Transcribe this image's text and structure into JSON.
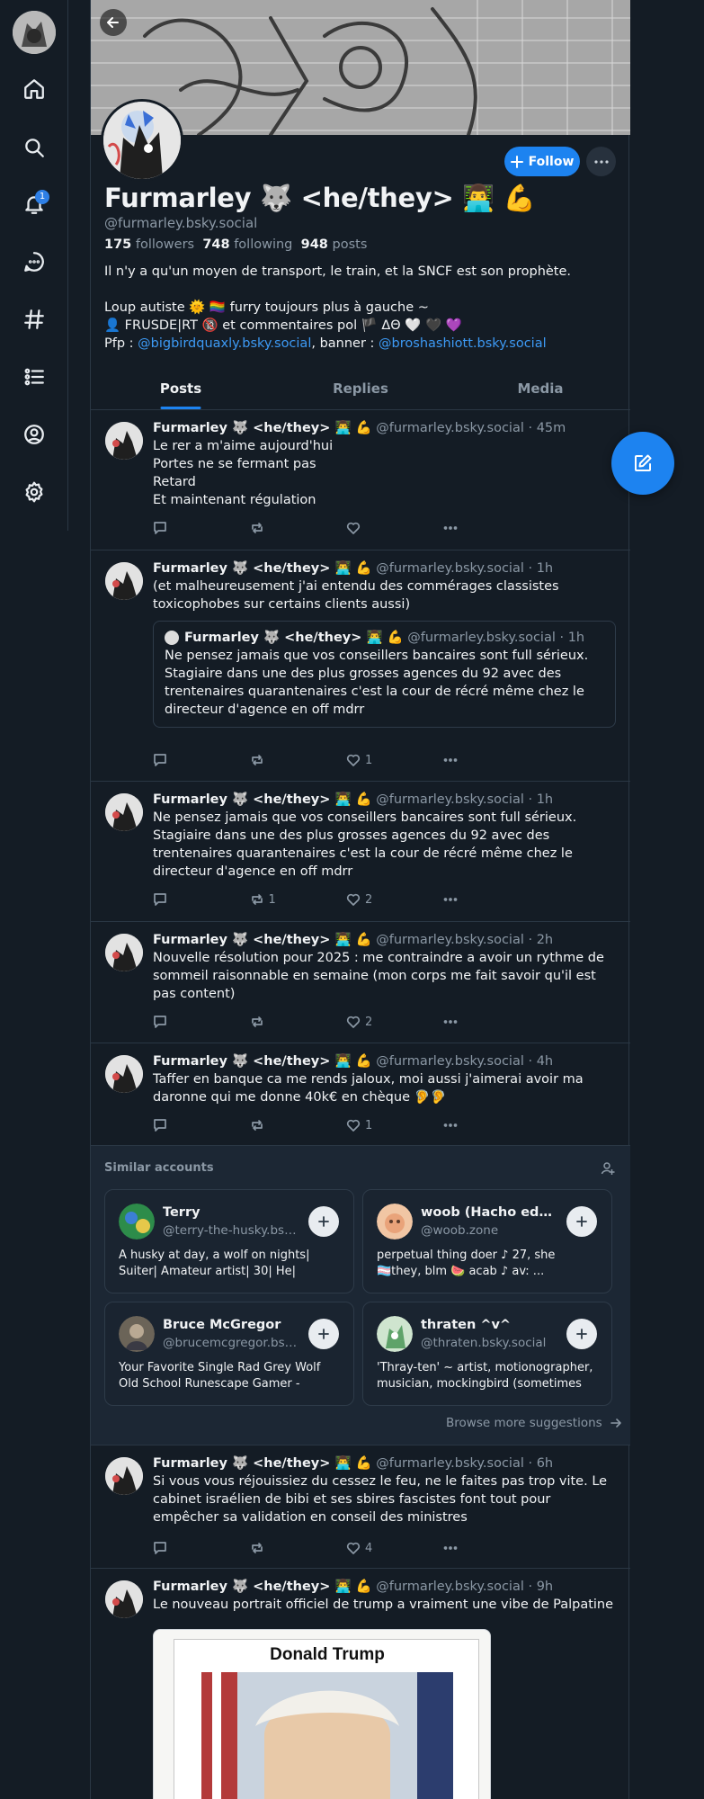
{
  "profile": {
    "display_name": "Furmarley 🐺 <he/they> 👨‍💻 💪",
    "handle": "@furmarley.bsky.social",
    "followers_count": "175",
    "followers_label": " followers",
    "following_count": "748",
    "following_label": " following",
    "posts_count": "948",
    "posts_label": " posts",
    "bio_line1": "Il n'y a qu'un moyen de transport, le train, et la SNCF est son prophète.",
    "bio_line2": "Loup autiste 🌞 🏳️‍🌈 furry toujours plus à gauche ~",
    "bio_line3": "👤 FRUSDE|RT 🔞 et commentaires pol 🏴 ΔΘ 🤍 🖤 💜",
    "bio_pfp_label": "Pfp : ",
    "bio_pfp_link": "@bigbirdquaxly.bsky.social",
    "bio_banner_label": ", banner : ",
    "bio_banner_link": "@broshashiott.bsky.social",
    "follow_label": "Follow"
  },
  "tabs": [
    "Posts",
    "Replies",
    "Media"
  ],
  "posts": [
    {
      "name": "Furmarley 🐺 <he/they> 👨‍💻 💪",
      "meta": " @furmarley.bsky.social · 45m",
      "text": "Le rer a m'aime aujourd'hui\nPortes ne se fermant pas\nRetard\nEt maintenant régulation",
      "reposts": "",
      "likes": ""
    },
    {
      "name": "Furmarley 🐺 <he/they> 👨‍💻 💪",
      "meta": " @furmarley.bsky.social · 1h",
      "text": "(et malheureusement j'ai entendu des commérages classistes toxicophobes sur certains clients aussi)",
      "quote_name": "Furmarley 🐺 <he/they> 👨‍💻 💪",
      "quote_meta": " @furmarley.bsky.social · 1h",
      "quote_text": "Ne pensez jamais que vos conseillers bancaires sont full sérieux. Stagiaire dans une des plus grosses agences du 92 avec des trentenaires quarantenaires c'est la cour de récré même chez le directeur d'agence en off mdrr",
      "reposts": "",
      "likes": "1"
    },
    {
      "name": "Furmarley 🐺 <he/they> 👨‍💻 💪",
      "meta": " @furmarley.bsky.social · 1h",
      "text": "Ne pensez jamais que vos conseillers bancaires sont full sérieux. Stagiaire dans une des plus grosses agences du 92 avec des trentenaires quarantenaires c'est la cour de récré même chez le directeur d'agence en off mdrr",
      "reposts": "1",
      "likes": "2"
    },
    {
      "name": "Furmarley 🐺 <he/they> 👨‍💻 💪",
      "meta": " @furmarley.bsky.social · 2h",
      "text": "Nouvelle résolution pour 2025 : me contraindre a avoir un rythme de sommeil raisonnable en semaine (mon corps me fait savoir qu'il est pas content)",
      "reposts": "",
      "likes": "2"
    },
    {
      "name": "Furmarley 🐺 <he/they> 👨‍💻 💪",
      "meta": " @furmarley.bsky.social · 4h",
      "text": "Taffer en banque ca me rends jaloux, moi aussi j'aimerai avoir ma daronne qui me donne 40k€ en chèque 🦻🦻",
      "reposts": "",
      "likes": "1"
    },
    {
      "name": "Furmarley 🐺 <he/they> 👨‍💻 💪",
      "meta": " @furmarley.bsky.social · 6h",
      "text": "Si vous vous réjouissiez du cessez le feu, ne le faites pas trop vite. Le cabinet israélien de bibi et ses sbires fascistes font tout pour empêcher sa validation en conseil des ministres",
      "reposts": "",
      "likes": "4"
    },
    {
      "name": "Furmarley 🐺 <he/they> 👨‍💻 💪",
      "meta": " @furmarley.bsky.social · 9h",
      "text": "Le nouveau portrait officiel de trump a vraiment une vibe de Palpatine",
      "image_caption": "Donald Trump"
    }
  ],
  "similar": {
    "title": "Similar accounts",
    "browse_label": "Browse more suggestions",
    "cards": [
      {
        "name": "Terry",
        "handle": "@terry-the-husky.bsk...",
        "desc": "A husky at day, a wolf on nights| Suiter| Amateur artist| 30| He| always...",
        "avatar_color": "#2d8c4a"
      },
      {
        "name": "woob (Hacho editi...",
        "handle": "@woob.zone",
        "desc": "perpetual thing doer ♪ 27, she 🏳️‍⚧️they, blm 🍉 acab ♪ av: ...",
        "avatar_color": "#e9a37a"
      },
      {
        "name": "Bruce McGregor",
        "handle": "@brucemcgregor.bsk...",
        "desc": "Your Favorite Single Rad Grey Wolf Old School Runescape Gamer - Minin...",
        "avatar_color": "#6b6458"
      },
      {
        "name": "thraten ^v^",
        "handle": "@thraten.bsky.social",
        "desc": "'Thray-ten' ~ artist, motionographer, musician, mockingbird (sometimes s...",
        "avatar_color": "#5fa36a"
      }
    ]
  },
  "nav": {
    "notification_badge": "1",
    "icons": [
      "home-icon",
      "search-icon",
      "bell-icon",
      "chat-icon",
      "hashtag-icon",
      "list-icon",
      "profile-icon",
      "settings-icon"
    ]
  },
  "colors": {
    "accent": "#1d83f0",
    "background": "#141c25",
    "muted": "#8b98a5"
  }
}
